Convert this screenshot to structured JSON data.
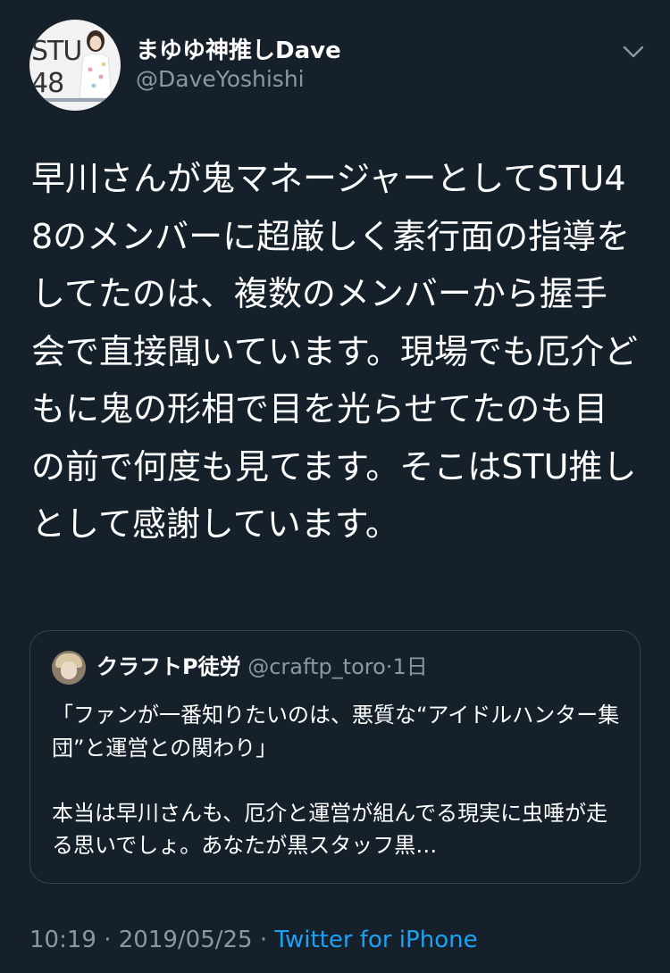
{
  "author": {
    "display_name": "まゆゆ神推しDave",
    "handle": "@DaveYoshishi",
    "avatar_logo_text": "STU\n48"
  },
  "icons": {
    "menu": "chevron-down-icon"
  },
  "tweet": {
    "text": "早川さんが鬼マネージャーとしてSTU48のメンバーに超厳しく素行面の指導をしてたのは、複数のメンバーから握手会で直接聞いています。現場でも厄介どもに鬼の形相で目を光らせてたのも目の前で何度も見てます。そこはSTU推しとして感謝しています。"
  },
  "quoted_tweet": {
    "display_name": "クラフトP徒労",
    "handle": "@craftp_toro",
    "separator": "·",
    "time": "1日",
    "text": "「ファンが一番知りたいのは、悪質な“アイドルハンター集団”と運営との関わり」\n\n本当は早川さんも、厄介と運営が組んでる現実に虫唾が走る思いでしょ。あなたが黒スタッフ黒…"
  },
  "meta": {
    "time": "10:19",
    "date": "2019/05/25",
    "separator": "·",
    "source": "Twitter for iPhone"
  },
  "colors": {
    "background": "#15202b",
    "primary_text": "#ffffff",
    "secondary_text": "#8899a6",
    "link": "#1da1f2",
    "border": "#38444d"
  }
}
